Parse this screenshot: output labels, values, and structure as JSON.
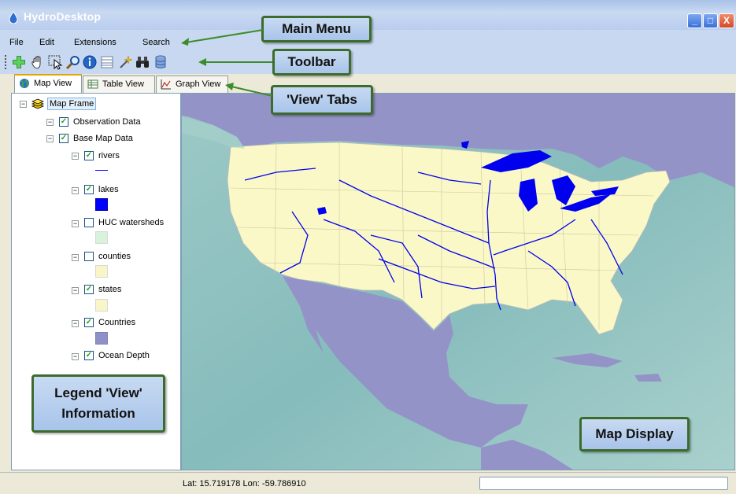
{
  "window": {
    "title": "HydroDesktop",
    "minimize": "_",
    "maximize": "□",
    "close": "X"
  },
  "menu": {
    "items": [
      "File",
      "Edit",
      "Extensions",
      "Search"
    ]
  },
  "toolbar": {
    "buttons": [
      "add-layer-icon",
      "pan-hand-icon",
      "select-icon",
      "zoom-icon",
      "info-icon",
      "attribute-table-icon",
      "wand-icon",
      "binoculars-icon",
      "database-icon"
    ]
  },
  "tabs": [
    {
      "label": "Map View",
      "active": true
    },
    {
      "label": "Table View",
      "active": false
    },
    {
      "label": "Graph View",
      "active": false
    }
  ],
  "legend": {
    "root": "Map Frame",
    "groups": [
      {
        "label": "Observation Data",
        "checked": true
      },
      {
        "label": "Base Map Data",
        "checked": true
      }
    ],
    "layers": [
      {
        "label": "rivers",
        "checked": true,
        "swatch": "line",
        "color": "#0000ff"
      },
      {
        "label": "lakes",
        "checked": true,
        "swatch": "fill",
        "color": "#0000ff"
      },
      {
        "label": "HUC watersheds",
        "checked": false,
        "swatch": "fill",
        "color": "#d9f2dc"
      },
      {
        "label": "counties",
        "checked": false,
        "swatch": "fill",
        "color": "#f8f6c8"
      },
      {
        "label": "states",
        "checked": true,
        "swatch": "fill",
        "color": "#f8f6c8"
      },
      {
        "label": "Countries",
        "checked": true,
        "swatch": "fill",
        "color": "#9090c8"
      },
      {
        "label": "Ocean Depth",
        "checked": true,
        "swatch": "none",
        "color": ""
      }
    ]
  },
  "status": {
    "coords": "Lat: 15.719178 Lon: -59.786910"
  },
  "callouts": {
    "main_menu": "Main Menu",
    "toolbar": "Toolbar",
    "view_tabs": "'View' Tabs",
    "legend_line1": "Legend 'View'",
    "legend_line2": "Information",
    "map_display": "Map Display"
  },
  "colors": {
    "ocean": "#8fc2c2",
    "land_other": "#9494c8",
    "usa": "#fbf8c8",
    "water": "#0000ee",
    "callout_border": "#3c6b2b"
  }
}
